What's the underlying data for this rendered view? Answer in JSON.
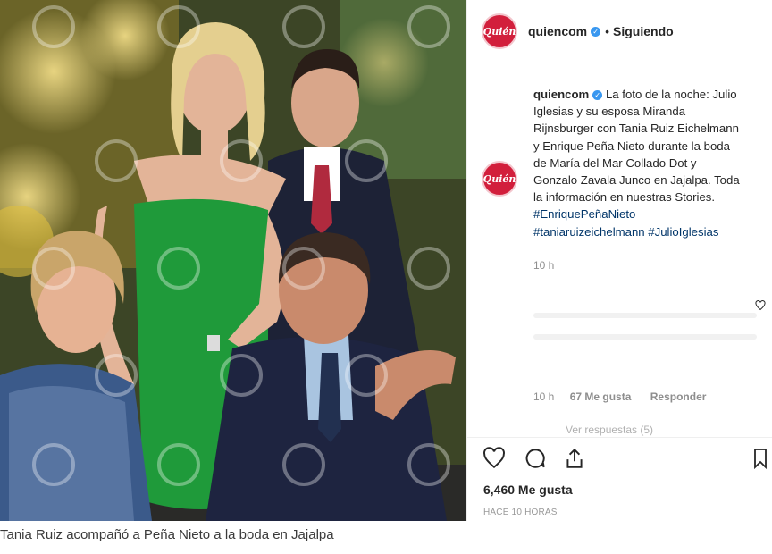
{
  "post": {
    "username": "quiencom",
    "separator": "•",
    "follow_status": "Siguiendo",
    "logo_text": "Quién",
    "caption_username": "quiencom",
    "caption_lines": [
      "La foto de la noche: Julio",
      "Iglesias y su esposa Miranda",
      "Rijnsburger con Tania Ruiz Eichelmann",
      "y Enrique Peña Nieto durante la boda",
      "de María del Mar Collado Dot y",
      "Gonzalo Zavala Junco en Jajalpa. Toda",
      "la información en nuestras Stories."
    ],
    "hashtags": [
      "#EnriquePeñaNieto",
      "#taniaruizeichelmann #JulioIglesias"
    ],
    "caption_time": "10 h",
    "comment_time": "10 h",
    "comment_likes": "67 Me gusta",
    "reply_label": "Responder",
    "see_replies": "Ver respuestas (5)",
    "likes_total": "6,460 Me gusta",
    "posted_ago": "HACE 10 HORAS"
  },
  "article": {
    "photo_caption": "Tania Ruiz acompañó a Peña Nieto a la boda en Jajalpa"
  },
  "icons": {
    "like": "heart-icon",
    "comment": "comment-icon",
    "share": "share-icon",
    "save": "bookmark-icon"
  },
  "colors": {
    "brand": "#d21f3c",
    "verified": "#3897f0",
    "hashtag": "#003569",
    "dress": "#1f9a3a"
  }
}
